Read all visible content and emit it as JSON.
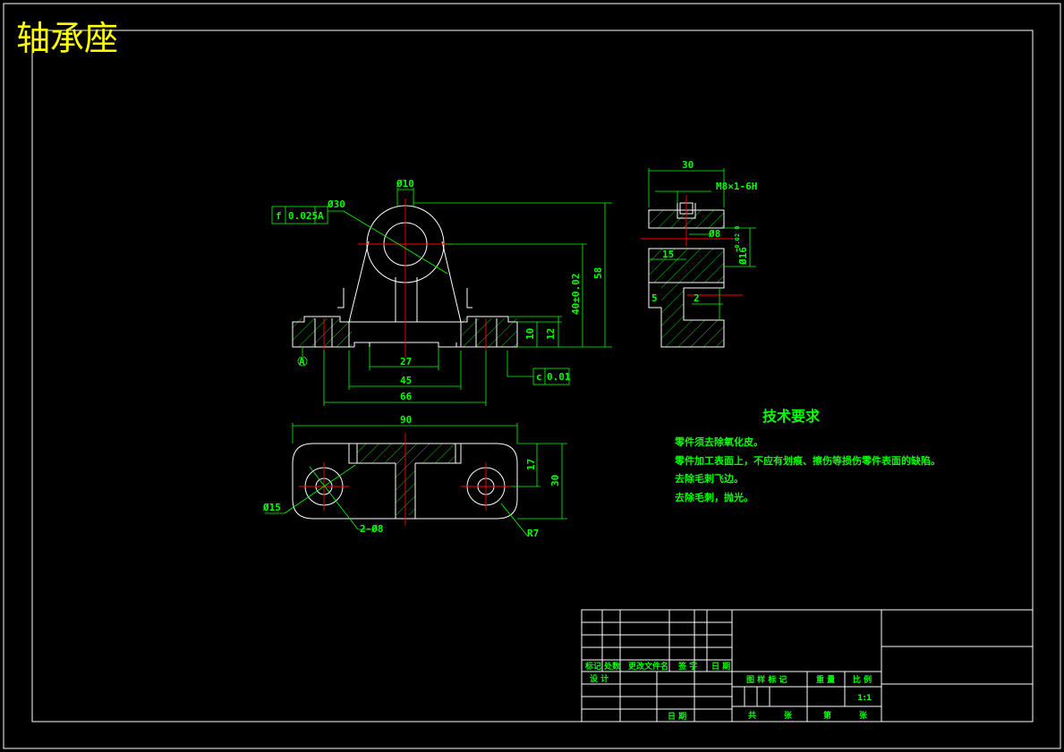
{
  "title": "轴承座",
  "colors": {
    "background": "#000000",
    "outline": "#ffffff",
    "dimension": "#00ff00",
    "centerline": "#ff0000",
    "title": "#ffff00"
  },
  "front_view": {
    "dims": {
      "bore_small": "Ø10",
      "bore_large": "Ø30",
      "height_58": "58",
      "height_40": "40±0.02",
      "base_10": "10",
      "base_12": "12",
      "slot_27": "27",
      "holes_45": "45",
      "width_66": "66"
    },
    "tolerance_top": {
      "symbol": "f",
      "value": "0.025",
      "datum": "A"
    },
    "tolerance_bottom": {
      "symbol": "c",
      "value": "0.01"
    },
    "datum_label": "A"
  },
  "side_view": {
    "dims": {
      "width_30": "30",
      "thread": "M8×1-6H",
      "bore_8": "Ø8",
      "dia_16": "Ø16",
      "tol_16": "+0.02 0",
      "len_15": "15",
      "gap_5": "5",
      "gap_2": "2"
    }
  },
  "top_view": {
    "dims": {
      "length_90": "90",
      "width_17": "17",
      "width_30": "30",
      "dia_15": "Ø15",
      "holes": "2-Ø8",
      "radius": "R7"
    }
  },
  "tech_requirements": {
    "heading": "技术要求",
    "items": [
      "零件须去除氧化皮。",
      "零件加工表面上，不应有划痕、擦伤等损伤零件表面的缺陷。",
      "去除毛刺飞边。",
      "去除毛刺，抛光。"
    ]
  },
  "title_block": {
    "rev_headers": [
      "标记",
      "处数",
      "更改文件名",
      "签 字",
      "日 期"
    ],
    "design": "设 计",
    "date": "日 期",
    "stage_headers": [
      "图 样 标 记",
      "重 量",
      "比 例"
    ],
    "scale": "1:1",
    "sheet_cells": [
      "共",
      "张",
      "第",
      "张"
    ]
  }
}
